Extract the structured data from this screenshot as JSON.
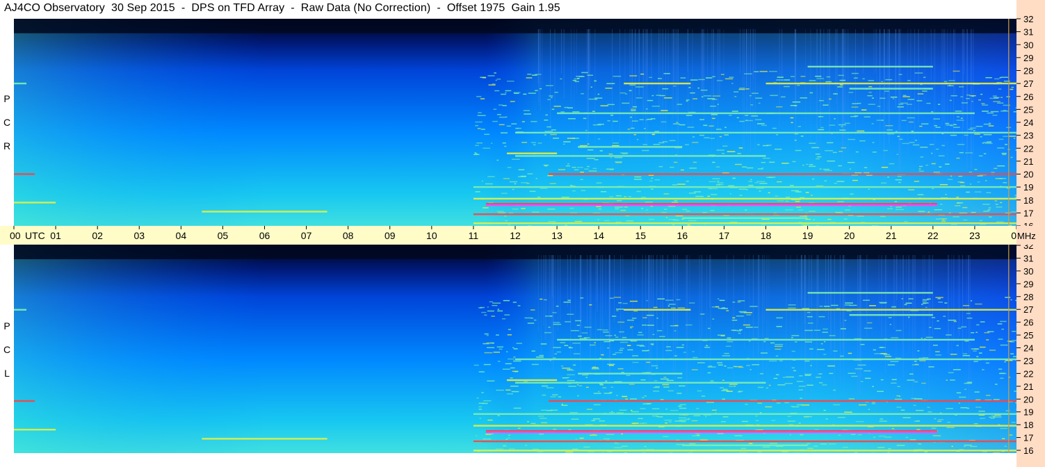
{
  "title": "AJ4CO Observatory  30 Sep 2015  -  DPS on TFD Array  -  Raw Data (No Correction)  -  Offset 1975  Gain 1.95",
  "panels": [
    {
      "name": "top",
      "polarization_letters": [
        "P",
        "C",
        "R"
      ]
    },
    {
      "name": "bottom",
      "polarization_letters": [
        "P",
        "C",
        "L"
      ]
    }
  ],
  "chart_data": {
    "type": "heatmap",
    "title": "AJ4CO Observatory  30 Sep 2015  -  DPS on TFD Array  -  Raw Data (No Correction)  -  Offset 1975  Gain 1.95",
    "x_unit": "UTC",
    "y_unit": "MHz",
    "x_ticks": [
      "00",
      "01",
      "02",
      "03",
      "04",
      "05",
      "06",
      "07",
      "08",
      "09",
      "10",
      "11",
      "12",
      "13",
      "14",
      "15",
      "16",
      "17",
      "18",
      "19",
      "20",
      "21",
      "22",
      "23",
      "00"
    ],
    "y_ticks": [
      "32",
      "31",
      "30",
      "29",
      "28",
      "27",
      "26",
      "25",
      "24",
      "23",
      "22",
      "21",
      "20",
      "19",
      "18",
      "17",
      "16"
    ],
    "xlim": [
      0,
      24
    ],
    "ylim": [
      16,
      32
    ],
    "series": [
      {
        "name": "RCP"
      },
      {
        "name": "LCP"
      }
    ],
    "colormap": [
      "#000010",
      "#001a7a",
      "#0044d8",
      "#0088ff",
      "#18c8f0",
      "#80f0b0",
      "#e8f040",
      "#ff4040",
      "#ff40ff"
    ],
    "strong_signal_bands_mhz": [
      27.0,
      21.5,
      20.0,
      17.6,
      16.9
    ]
  }
}
